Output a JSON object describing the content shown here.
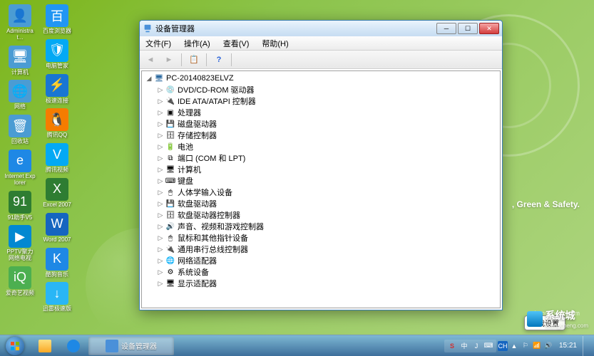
{
  "wallpaper": {
    "tagline": ", Green & Safety.",
    "url": "xitongcheng.com"
  },
  "desktop_icons": [
    {
      "label": "Administrat...",
      "bg": "#4B9CD3",
      "glyph": "👤"
    },
    {
      "label": "计算机",
      "bg": "#4B9CD3",
      "glyph": "🖥"
    },
    {
      "label": "网络",
      "bg": "#4B9CD3",
      "glyph": "🌐"
    },
    {
      "label": "回收站",
      "bg": "#4B9CD3",
      "glyph": "🗑"
    },
    {
      "label": "Internet Explorer",
      "bg": "#1E88E5",
      "glyph": "e"
    },
    {
      "label": "91助手V5",
      "bg": "#2E7D32",
      "glyph": "91"
    },
    {
      "label": "PPTV聚力网络电视",
      "bg": "#0288D1",
      "glyph": "▶"
    },
    {
      "label": "爱奇艺视频",
      "bg": "#4CAF50",
      "glyph": "iQ"
    },
    {
      "label": "百度浏览器",
      "bg": "#2196F3",
      "glyph": "百"
    },
    {
      "label": "电脑管家",
      "bg": "#03A9F4",
      "glyph": "🛡"
    },
    {
      "label": "极速连接",
      "bg": "#1976D2",
      "glyph": "⚡"
    },
    {
      "label": "腾讯QQ",
      "bg": "#F57C00",
      "glyph": "🐧"
    },
    {
      "label": "腾讯视频",
      "bg": "#03A9F4",
      "glyph": "V"
    },
    {
      "label": "Excel 2007",
      "bg": "#2E7D32",
      "glyph": "X"
    },
    {
      "label": "Word 2007",
      "bg": "#1565C0",
      "glyph": "W"
    },
    {
      "label": "酷狗音乐",
      "bg": "#1E88E5",
      "glyph": "K"
    },
    {
      "label": "迅雷极速版",
      "bg": "#29B6F6",
      "glyph": "↓"
    }
  ],
  "window": {
    "title": "设备管理器",
    "menus": [
      "文件(F)",
      "操作(A)",
      "查看(V)",
      "帮助(H)"
    ],
    "tree": {
      "root": "PC-20140823ELVZ",
      "children": [
        "DVD/CD-ROM 驱动器",
        "IDE ATA/ATAPI 控制器",
        "处理器",
        "磁盘驱动器",
        "存储控制器",
        "电池",
        "端口 (COM 和 LPT)",
        "计算机",
        "键盘",
        "人体学输入设备",
        "软盘驱动器",
        "软盘驱动器控制器",
        "声音、视频和游戏控制器",
        "鼠标和其他指针设备",
        "通用串行总线控制器",
        "网络适配器",
        "系统设备",
        "显示适配器"
      ]
    }
  },
  "taskbar": {
    "active_task": "设备管理器",
    "tooltip": "点我设置",
    "lang_badge": "CH",
    "ime_badges": [
      "S",
      "中",
      "J",
      "⌨"
    ],
    "clock": "15:21"
  },
  "watermark": {
    "brand": "系统城",
    "url": "xitongcheng.com"
  }
}
